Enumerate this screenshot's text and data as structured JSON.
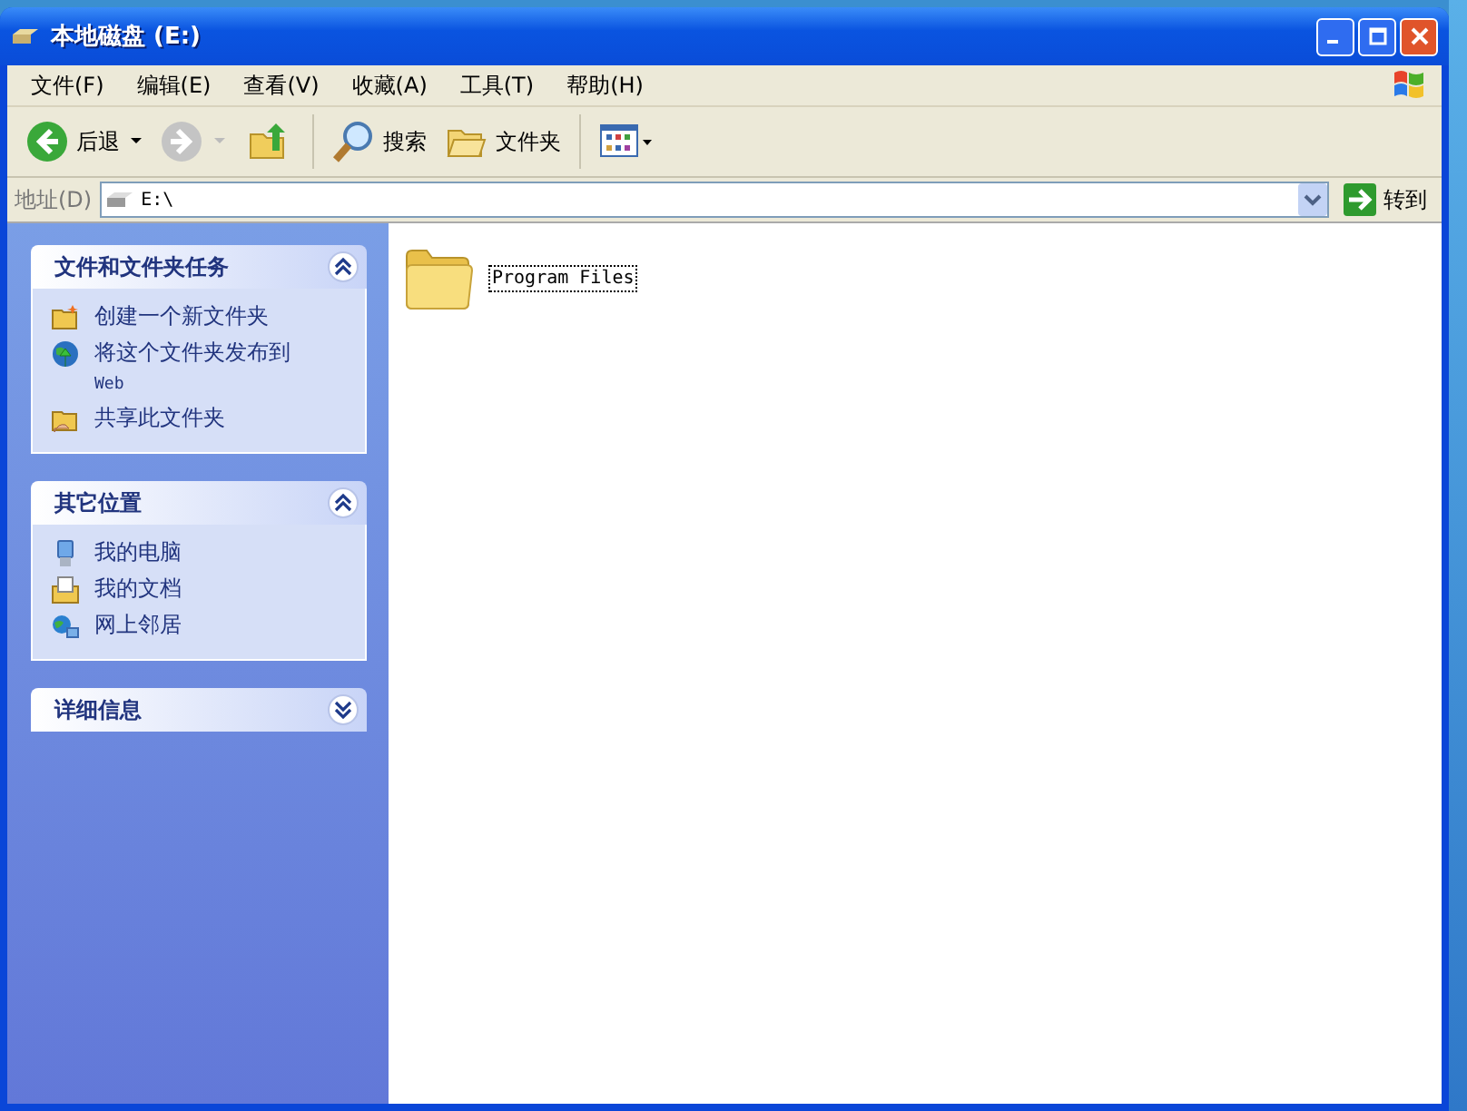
{
  "window": {
    "title": "本地磁盘 (E:)"
  },
  "menu": [
    "文件(F)",
    "编辑(E)",
    "查看(V)",
    "收藏(A)",
    "工具(T)",
    "帮助(H)"
  ],
  "toolbar": {
    "back": {
      "label": "后退",
      "disabled": false
    },
    "forward": {
      "disabled": true
    },
    "search": "搜索",
    "folders": "文件夹"
  },
  "address": {
    "label": "地址(D)",
    "value": "E:\\",
    "go": "转到"
  },
  "task_panes": [
    {
      "title": "文件和文件夹任务",
      "expanded": true,
      "items": [
        {
          "label": "创建一个新文件夹",
          "kind": "new-folder"
        },
        {
          "label": "将这个文件夹发布到",
          "sub": "Web",
          "kind": "publish"
        },
        {
          "label": "共享此文件夹",
          "kind": "share"
        }
      ]
    },
    {
      "title": "其它位置",
      "expanded": true,
      "items": [
        {
          "label": "我的电脑",
          "kind": "computer"
        },
        {
          "label": "我的文档",
          "kind": "documents"
        },
        {
          "label": "网上邻居",
          "kind": "network"
        }
      ]
    },
    {
      "title": "详细信息",
      "expanded": false
    }
  ],
  "files": [
    {
      "name": "Program Files",
      "selected": true
    }
  ]
}
